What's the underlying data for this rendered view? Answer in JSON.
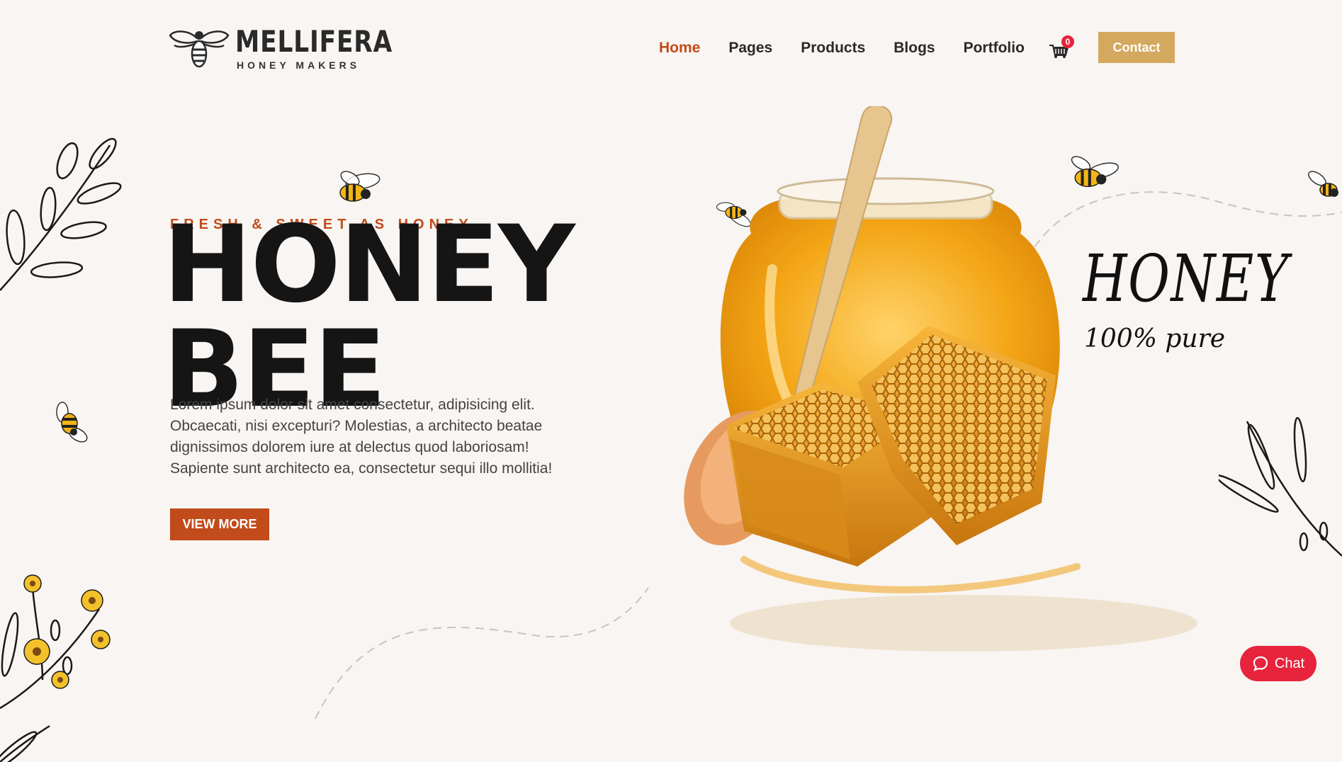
{
  "brand": {
    "name": "MELLIFERA",
    "tagline": "HONEY MAKERS"
  },
  "nav": {
    "items": [
      {
        "label": "Home",
        "active": true
      },
      {
        "label": "Pages"
      },
      {
        "label": "Products"
      },
      {
        "label": "Blogs"
      },
      {
        "label": "Portfolio"
      }
    ],
    "cart_count": "0",
    "contact_label": "Contact"
  },
  "hero": {
    "eyebrow": "FRESH & SWEET AS HONEY",
    "title_line1": "HONEY",
    "title_line2": "BEE",
    "body": "Lorem ipsum dolor sit amet consectetur, adipisicing elit. Obcaecati, nisi excepturi? Molestias, a architecto beatae dignissimos dolorem iure at delectus quod laboriosam! Sapiente sunt architecto ea, consectetur sequi illo mollitia!",
    "cta_label": "VIEW MORE"
  },
  "badge": {
    "title": "HONEY",
    "subtitle": "100% pure"
  },
  "chat": {
    "label": "Chat"
  },
  "colors": {
    "background": "#f8f5f2",
    "accent": "#c14b1a",
    "contact_button": "#d4a85f",
    "chat_button": "#e8233c",
    "honey": "#f0a21c"
  },
  "icons": [
    "bee-logo-icon",
    "cart-icon",
    "chat-bubble-icon",
    "bee-icon",
    "leaf-branch-icon",
    "flower-branch-icon"
  ]
}
